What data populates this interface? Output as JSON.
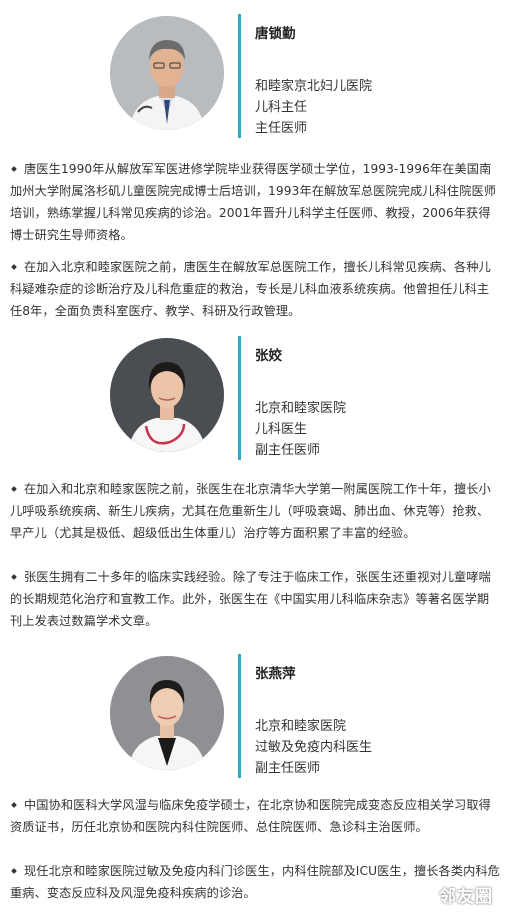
{
  "doctors": [
    {
      "name": "唐锁勤",
      "hospital": "和睦家京北妇儿医院",
      "department": "儿科主任",
      "title": "主任医师",
      "paragraphs": [
        "唐医生1990年从解放军军医进修学院毕业获得医学硕士学位，1993-1996年在美国南加州大学附属洛杉矶儿童医院完成博士后培训，1993年在解放军总医院完成儿科住院医师培训，熟练掌握儿科常见疾病的诊治。2001年晋升儿科学主任医师、教授，2006年获得博士研究生导师资格。",
        "在加入北京和睦家医院之前，唐医生在解放军总医院工作，擅长儿科常见疾病、各种儿科疑难杂症的诊断治疗及儿科危重症的救治，专长是儿科血液系统疾病。他曾担任儿科主任8年，全面负责科室医疗、教学、科研及行政管理。"
      ]
    },
    {
      "name": "张姣",
      "hospital": "北京和睦家医院",
      "department": "儿科医生",
      "title": "副主任医师",
      "paragraphs": [
        "在加入和北京和睦家医院之前，张医生在北京清华大学第一附属医院工作十年，擅长小儿呼吸系统疾病、新生儿疾病，尤其在危重新生儿（呼吸衰竭、肺出血、休克等）抢救、早产儿（尤其是极低、超级低出生体重儿）治疗等方面积累了丰富的经验。",
        "张医生拥有二十多年的临床实践经验。除了专注于临床工作，张医生还重视对儿童哮喘的长期规范化治疗和宣教工作。此外，张医生在《中国实用儿科临床杂志》等著名医学期刊上发表过数篇学术文章。"
      ]
    },
    {
      "name": "张燕萍",
      "hospital": "北京和睦家医院",
      "department": "过敏及免疫内科医生",
      "title": "副主任医师",
      "paragraphs": [
        "中国协和医科大学风湿与临床免疫学硕士，在北京协和医院完成变态反应相关学习取得资质证书，历任北京协和医院内科住院医师、总住院医师、急诊科主治医师。",
        "现任北京和睦家医院过敏及免疫内科门诊医生，内科住院部及ICU医生，擅长各类内科危重病、变态反应科及风湿免疫科疾病的诊治。"
      ]
    }
  ],
  "watermark": "邻友圈",
  "colors": {
    "accent_bar": "#2fa9c4",
    "text": "#333333"
  }
}
